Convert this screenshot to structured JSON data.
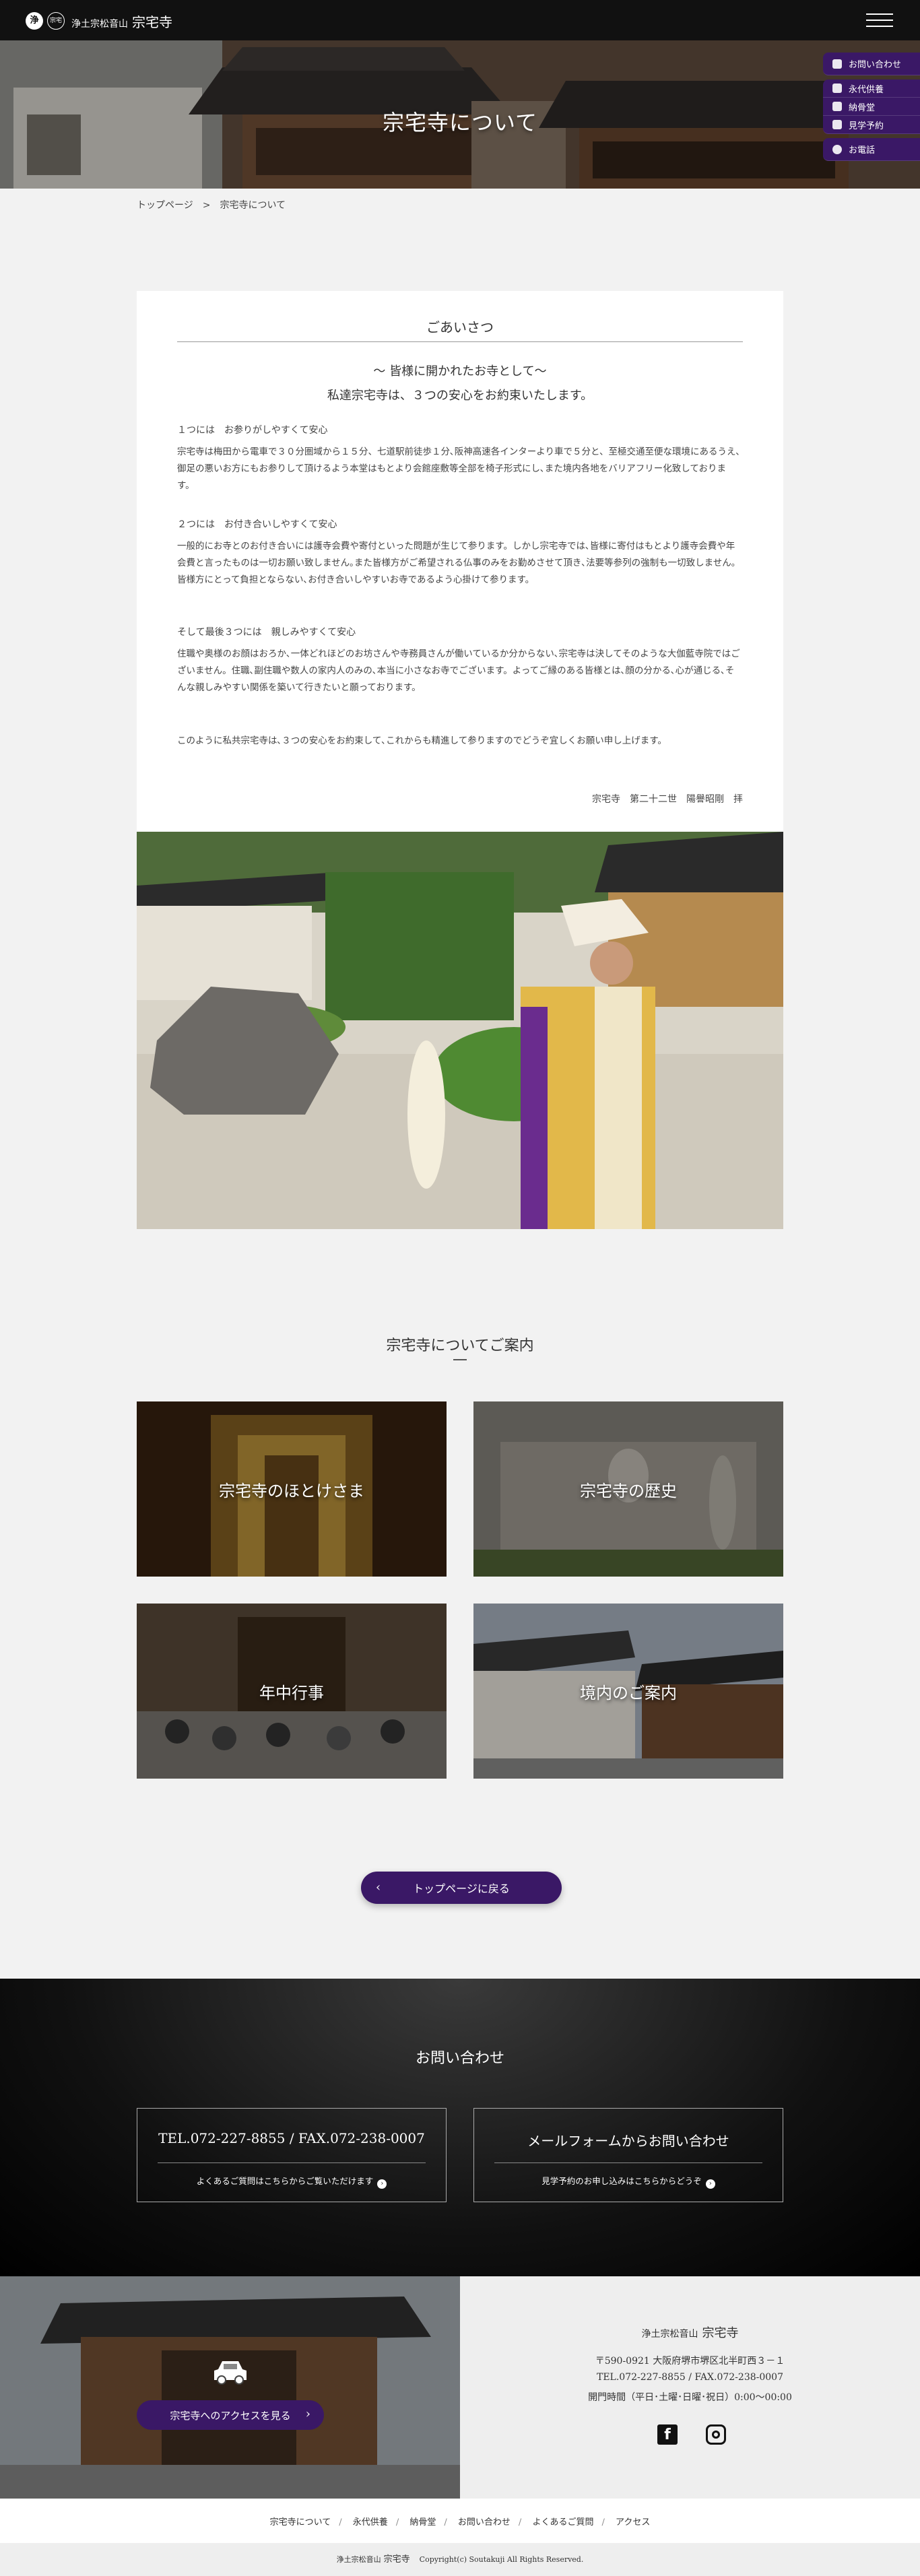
{
  "header": {
    "logo_mark": "浄",
    "logo_mark_small": "宗宅",
    "site_title_sub": "浄土宗松音山",
    "site_title_main": "宗宅寺"
  },
  "hero": {
    "title": "宗宅寺について"
  },
  "side_nav": [
    {
      "label": "お問い合わせ",
      "icon": "mail-icon"
    },
    {
      "label": "永代供養",
      "icon": "lotus-icon"
    },
    {
      "label": "納骨堂",
      "icon": "building-icon"
    },
    {
      "label": "見学予約",
      "icon": "calendar-icon"
    },
    {
      "label": "お電話",
      "icon": "phone-icon"
    }
  ],
  "breadcrumb": {
    "home": "トップページ",
    "sep": ">",
    "current": "宗宅寺について"
  },
  "greeting": {
    "title": "ごあいさつ",
    "lead1": "～ 皆様に開かれたお寺として～",
    "lead2": "私達宗宅寺は、３つの安心をお約束いたします。",
    "point1_head": "１つには　お参りがしやすくて安心",
    "point1_body": "宗宅寺は梅田から電車で３０分圏域から１５分、七道駅前徒歩１分､阪神高速各インターより車で５分と、至極交通至便な環境にあるうえ､御足の悪いお方にもお参りして頂けるよう本堂はもとより会館座敷等全部を椅子形式にし､また境内各地をバリアフリー化致しております。",
    "point2_head": "２つには　お付き合いしやすくて安心",
    "point2_body": "一般的にお寺とのお付き合いには護寺会費や寄付といった問題が生じて参ります。しかし宗宅寺では､皆様に寄付はもとより護寺会費や年会費と言ったものは一切お願い致しません｡また皆様方がご希望される仏事のみをお勤めさせて頂き､法要等参列の強制も一切致しません｡皆様方にとって負担とならない､お付き合いしやすいお寺であるよう心掛けて参ります。",
    "point3_head": "そして最後３つには　親しみやすくて安心",
    "point3_body": "住職や奥様のお顔はおろか､一体どれほどのお坊さんや寺務員さんが働いているか分からない､宗宅寺は決してそのような大伽藍寺院ではございません。住職､副住職や数人の家内人のみの､本当に小さなお寺でございます。よってご縁のある皆様とは､顔の分かる､心が通じる､そんな親しみやすい関係を築いて行きたいと願っております。",
    "closing": "このように私共宗宅寺は､３つの安心をお約束して､これからも精進して参りますのでどうぞ宜しくお願い申し上げます。",
    "signature": "宗宅寺　第二十二世　陽譽昭剛　拝"
  },
  "guide": {
    "title": "宗宅寺についてご案内",
    "tiles": [
      {
        "label": "宗宅寺のほとけさま"
      },
      {
        "label": "宗宅寺の歴史"
      },
      {
        "label": "年中行事"
      },
      {
        "label": "境内のご案内"
      }
    ],
    "back_button": "トップページに戻る"
  },
  "contact": {
    "title": "お問い合わせ",
    "phone_box": {
      "main": "TEL.072-227-8855 / FAX.072-238-0007",
      "sub": "よくあるご質問はこちらからご覧いただけます"
    },
    "mail_box": {
      "main": "メールフォームからお問い合わせ",
      "sub": "見学予約のお申し込みはこちらからどうぞ"
    }
  },
  "access": {
    "button": "宗宅寺へのアクセスを見る",
    "temple_sub": "浄土宗松音山",
    "temple_name": "宗宅寺",
    "address": "〒590-0921 大阪府堺市堺区北半町西３－１",
    "tel": "TEL.072-227-8855 / FAX.072-238-0007",
    "hours": "開門時間（平日･土曜･日曜･祝日）0:00〜00:00"
  },
  "footer": {
    "nav": [
      "宗宅寺について",
      "永代供養",
      "納骨堂",
      "お問い合わせ",
      "よくあるご質問",
      "アクセス"
    ],
    "copy_sub": "浄土宗松音山",
    "copy_name": "宗宅寺",
    "copyright": "Copyright(c) Soutakuji All Rights Reserved."
  },
  "colors": {
    "accent": "#3a1866",
    "header_bg": "#111111",
    "contact_bg": "#000000"
  }
}
